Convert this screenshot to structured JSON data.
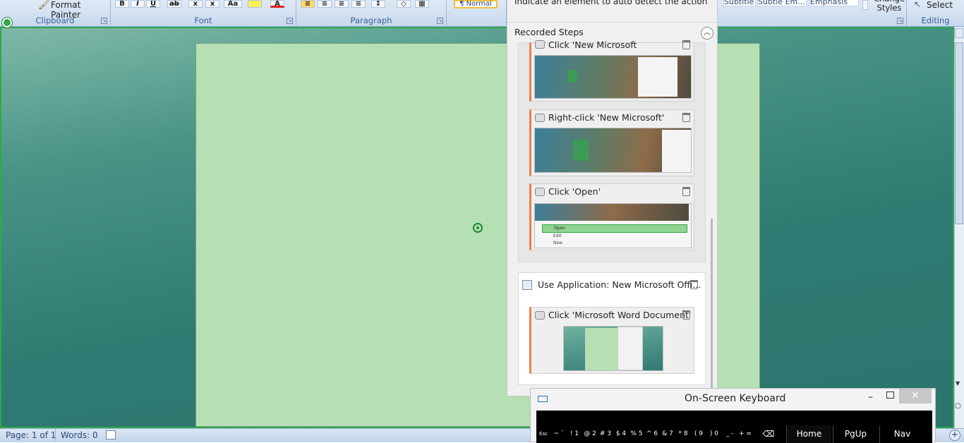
{
  "ribbon": {
    "clipboard": {
      "format_painter": "Format Painter",
      "label": "Clipboard"
    },
    "font": {
      "label": "Font"
    },
    "paragraph": {
      "label": "Paragraph"
    },
    "styles": {
      "normal": "¶ Normal",
      "subtitle": "Subtitle",
      "subtle_emphasis": "Subtle Em...",
      "emphasis": "Emphasis",
      "change_styles": "Change Styles"
    },
    "editing": {
      "select": "Select",
      "label": "Editing"
    }
  },
  "status_bar": {
    "page": "Page: 1 of 1",
    "words": "Words: 0"
  },
  "recorder": {
    "hint": "Indicate an element to auto detect the action",
    "recorded_steps_label": "Recorded Steps",
    "steps": [
      {
        "title": "Click 'New Microsoft"
      },
      {
        "title": "Right-click 'New Microsoft'"
      },
      {
        "title": "Click 'Open'"
      }
    ],
    "context_menu": {
      "open": "Open",
      "edit": "Edit",
      "new": "New"
    },
    "application_scope": {
      "title": "Use Application: New Microsoft Offi...",
      "step_title": "Click 'Microsoft Word Document'"
    }
  },
  "keyboard": {
    "title": "On-Screen Keyboard",
    "keys": [
      {
        "label": "Esc"
      },
      {
        "label": "~ `"
      },
      {
        "label": "! 1"
      },
      {
        "label": "@ 2"
      },
      {
        "label": "# 3"
      },
      {
        "label": "$ 4"
      },
      {
        "label": "% 5"
      },
      {
        "label": "^ 6"
      },
      {
        "label": "& 7"
      },
      {
        "label": "* 8"
      },
      {
        "label": "( 9"
      },
      {
        "label": ") 0"
      },
      {
        "label": "_ -"
      },
      {
        "label": "+ ="
      },
      {
        "label": "⌫"
      },
      {
        "label": "Home"
      },
      {
        "label": "PgUp"
      },
      {
        "label": "Nav"
      }
    ]
  },
  "colors": {
    "accent": "#f07d4c",
    "page": "#b6dfb3",
    "frame": "#2fa84a"
  }
}
